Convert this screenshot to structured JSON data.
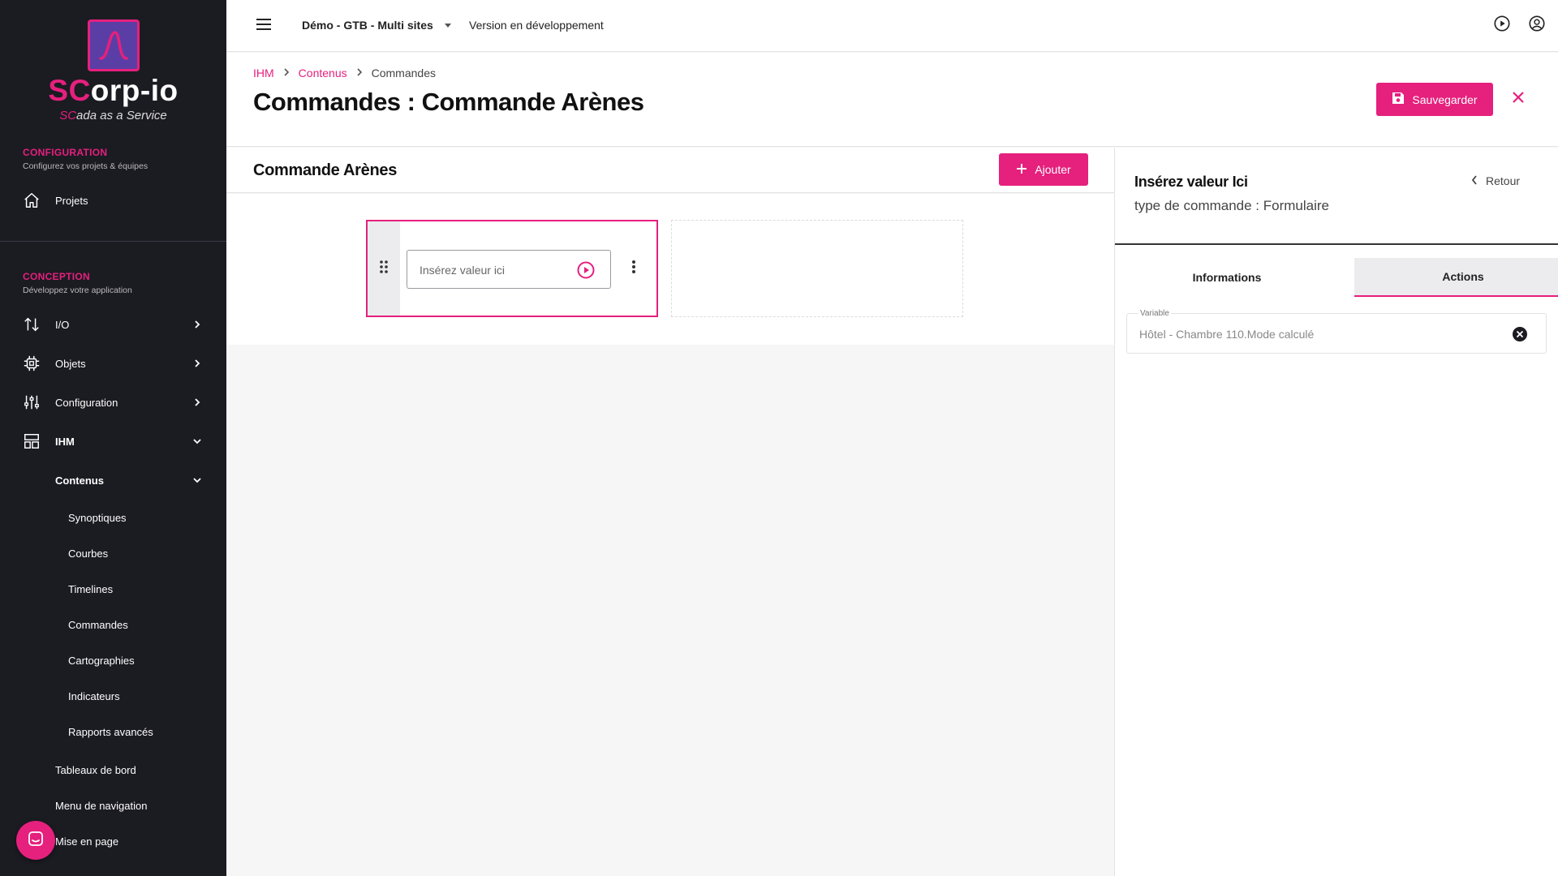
{
  "brand": {
    "name_accent": "SC",
    "name_rest": "orp-io",
    "tagline_accent": "SC",
    "tagline_rest": "ada as a Service",
    "accent_color": "#e5207d"
  },
  "sidebar": {
    "sections": [
      {
        "title": "CONFIGURATION",
        "subtitle": "Configurez vos projets & équipes"
      },
      {
        "title": "CONCEPTION",
        "subtitle": "Développez votre application"
      }
    ],
    "projects_label": "Projets",
    "items": [
      {
        "label": "I/O",
        "icon": "arrows-up-down-icon"
      },
      {
        "label": "Objets",
        "icon": "chip-icon"
      },
      {
        "label": "Configuration",
        "icon": "sliders-icon"
      },
      {
        "label": "IHM",
        "icon": "layout-icon"
      }
    ],
    "ihm_children": {
      "contenus_label": "Contenus",
      "contenus_children": [
        "Synoptiques",
        "Courbes",
        "Timelines",
        "Commandes",
        "Cartographies",
        "Indicateurs",
        "Rapports avancés"
      ],
      "others": [
        "Tableaux de bord",
        "Menu de navigation",
        "Mise en page"
      ]
    }
  },
  "topbar": {
    "project": "Démo - GTB - Multi sites",
    "version": "Version en développement",
    "icons": [
      "play-circle-icon",
      "account-circle-icon"
    ]
  },
  "header": {
    "breadcrumb": [
      "IHM",
      "Contenus",
      "Commandes"
    ],
    "title": "Commandes : Commande Arènes",
    "save_label": "Sauvegarder"
  },
  "main": {
    "title": "Commande Arènes",
    "add_label": "Ajouter",
    "command_input_placeholder": "Insérez valeur ici"
  },
  "panel": {
    "title": "Insérez valeur Ici",
    "subtitle": "type de commande : Formulaire",
    "back_label": "Retour",
    "tabs": [
      {
        "label": "Informations",
        "active": false
      },
      {
        "label": "Actions",
        "active": true
      }
    ],
    "variable_label": "Variable",
    "variable_value": "Hôtel - Chambre 110.Mode calculé"
  }
}
